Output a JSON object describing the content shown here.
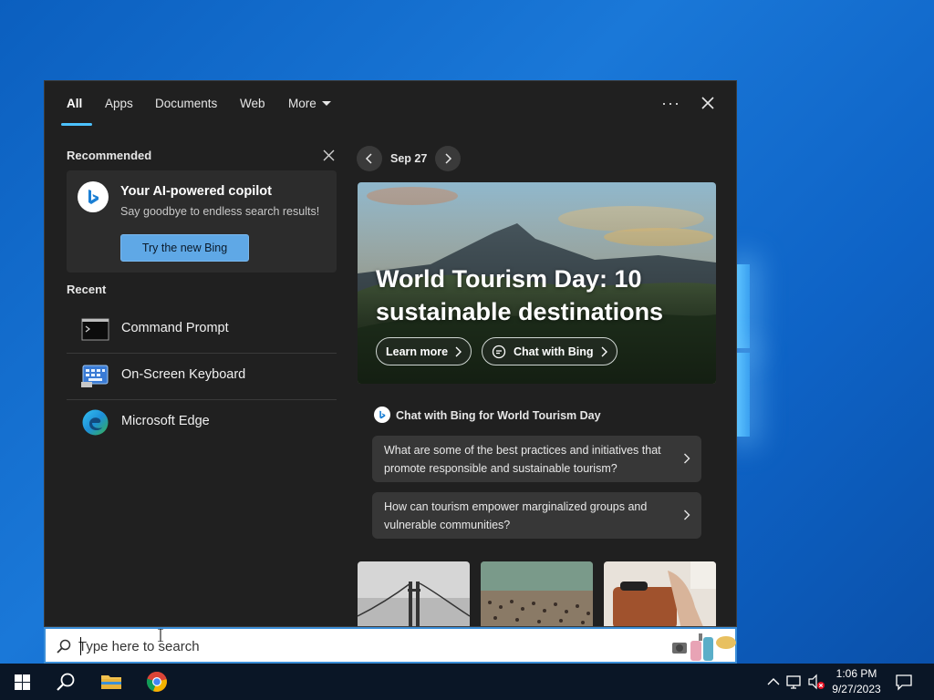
{
  "tabs": [
    {
      "label": "All"
    },
    {
      "label": "Apps"
    },
    {
      "label": "Documents"
    },
    {
      "label": "Web"
    },
    {
      "label": "More"
    }
  ],
  "recommended": {
    "title": "Recommended",
    "card_title": "Your AI-powered copilot",
    "card_subtitle": "Say goodbye to endless search results!",
    "button_label": "Try the new Bing"
  },
  "recent": {
    "title": "Recent",
    "items": [
      {
        "label": "Command Prompt",
        "icon": "command-prompt-icon"
      },
      {
        "label": "On-Screen Keyboard",
        "icon": "keyboard-icon"
      },
      {
        "label": "Microsoft Edge",
        "icon": "edge-icon"
      }
    ]
  },
  "feature": {
    "date": "Sep 27",
    "title": "World Tourism Day: 10 sustainable destinations",
    "learn_more": "Learn more",
    "chat_with_bing": "Chat with Bing"
  },
  "chat": {
    "heading": "Chat with Bing for World Tourism Day",
    "prompts": [
      "What are some of the best practices and initiatives that promote responsible and sustainable tourism?",
      "How can tourism empower marginalized groups and vulnerable communities?"
    ]
  },
  "search": {
    "placeholder": "Type here to search"
  },
  "clock": {
    "time": "1:06 PM",
    "date": "9/27/2023"
  },
  "colors": {
    "accent": "#4cc2ff",
    "panel_bg": "#202020",
    "card_bg": "#2c2c2c",
    "button_bg": "#5fa8e6",
    "taskbar_bg": "#0a1626"
  }
}
